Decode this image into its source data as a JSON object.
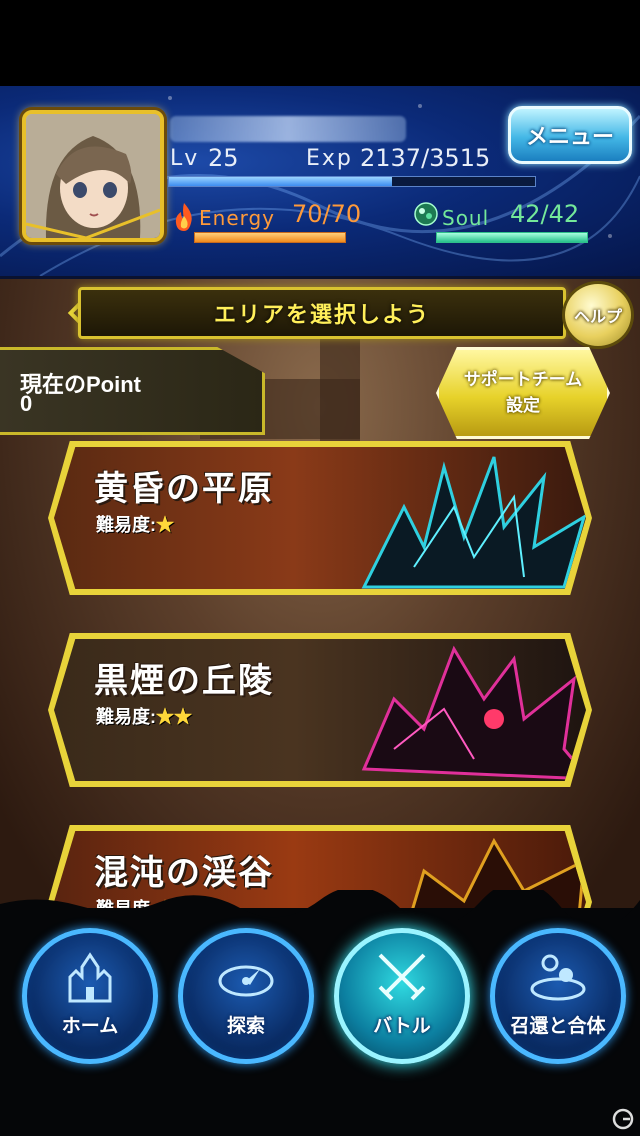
{
  "header": {
    "level_label": "Lv",
    "level": "25",
    "exp_label": "Exp",
    "exp_value": "2137/3515",
    "exp_fraction": 0.61,
    "energy_label": "Energy",
    "energy_value": "70/70",
    "energy_fraction": 1.0,
    "soul_label": "Soul",
    "soul_value": "42/42",
    "soul_fraction": 1.0,
    "menu_label": "メニュー"
  },
  "area_select": {
    "banner": "エリアを選択しよう",
    "help_label": "ヘルプ",
    "point_label": "現在のPoint",
    "point_value": "0",
    "support_line1": "サポートチーム",
    "support_line2": "設定"
  },
  "areas": [
    {
      "name": "黄昏の平原",
      "difficulty_label": "難易度:",
      "stars": "★",
      "color": "#2fd0e0"
    },
    {
      "name": "黒煙の丘陵",
      "difficulty_label": "難易度:",
      "stars": "★★",
      "color": "#e0309a"
    },
    {
      "name": "混沌の渓谷",
      "difficulty_label": "難易度:",
      "stars": "★★★",
      "color": "#e0a020"
    }
  ],
  "nav": [
    {
      "label": "ホーム",
      "icon": "castle-icon"
    },
    {
      "label": "探索",
      "icon": "compass-icon"
    },
    {
      "label": "バトル",
      "icon": "crossed-swords-icon"
    },
    {
      "label": "召還と合体",
      "icon": "summon-circle-icon"
    }
  ]
}
